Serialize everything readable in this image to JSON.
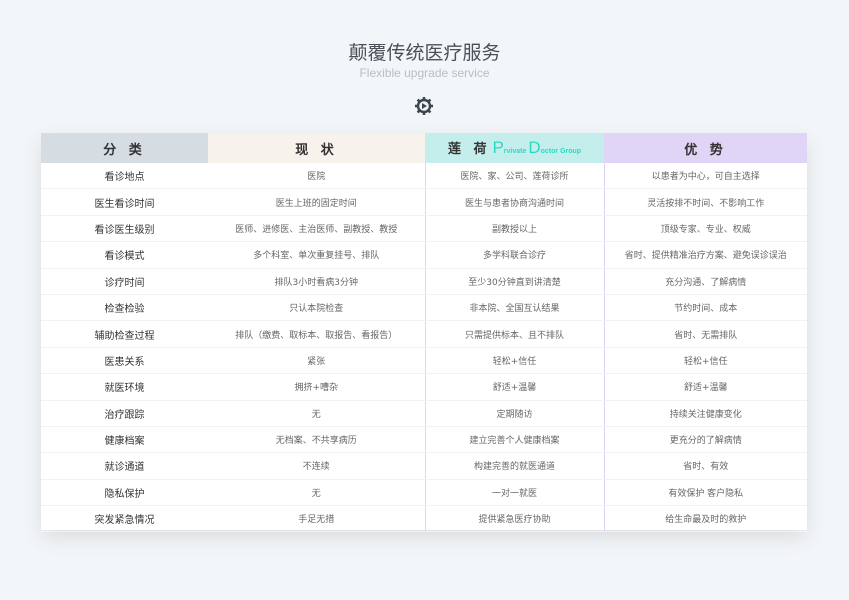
{
  "header": {
    "title": "颠覆传统医疗服务",
    "subtitle": "Flexible upgrade service",
    "icon": "gear-icon"
  },
  "table": {
    "columns": [
      "分 类",
      "现 状",
      "莲 荷",
      "优 势"
    ],
    "brand": {
      "p": "P",
      "rvivate": "rvivate ",
      "d": "D",
      "octor": "octor Group"
    },
    "header_colors": [
      "#d5dde2",
      "#f7f3ec",
      "#c4eeec",
      "#e0d4f7"
    ],
    "rows": [
      [
        "看诊地点",
        "医院",
        "医院、家、公司、莲荷诊所",
        "以患者为中心，可自主选择"
      ],
      [
        "医生看诊时间",
        "医生上班的固定时间",
        "医生与患者协商沟通时间",
        "灵活按排不时间、不影响工作"
      ],
      [
        "看诊医生级别",
        "医师、进修医、主治医师、副教授、教授",
        "副教授以上",
        "顶级专家、专业、权威"
      ],
      [
        "看诊模式",
        "多个科室、单次重复挂号、排队",
        "多学科联合诊疗",
        "省时、提供精准治疗方案、避免误诊误治"
      ],
      [
        "诊疗时间",
        "排队3小时看病3分钟",
        "至少30分钟直到讲清楚",
        "充分沟通、了解病情"
      ],
      [
        "检查检验",
        "只认本院检查",
        "非本院、全国互认结果",
        "节约时间、成本"
      ],
      [
        "辅助检查过程",
        "排队（缴费、取标本、取报告、看报告）",
        "只需提供标本、且不排队",
        "省时、无需排队"
      ],
      [
        "医患关系",
        "紧张",
        "轻松+信任",
        "轻松+信任"
      ],
      [
        "就医环境",
        "拥挤+嘈杂",
        "舒适+温馨",
        "舒适+温馨"
      ],
      [
        "治疗跟踪",
        "无",
        "定期随访",
        "持续关注健康变化"
      ],
      [
        "健康档案",
        "无档案、不共享病历",
        "建立完善个人健康档案",
        "更充分的了解病情"
      ],
      [
        "就诊通道",
        "不连续",
        "构建完善的就医通道",
        "省时、有效"
      ],
      [
        "隐私保护",
        "无",
        "一对一就医",
        "有效保护 客户隐私"
      ],
      [
        "突发紧急情况",
        "手足无措",
        "提供紧急医疗协助",
        "给生命最及时的救护"
      ]
    ]
  }
}
